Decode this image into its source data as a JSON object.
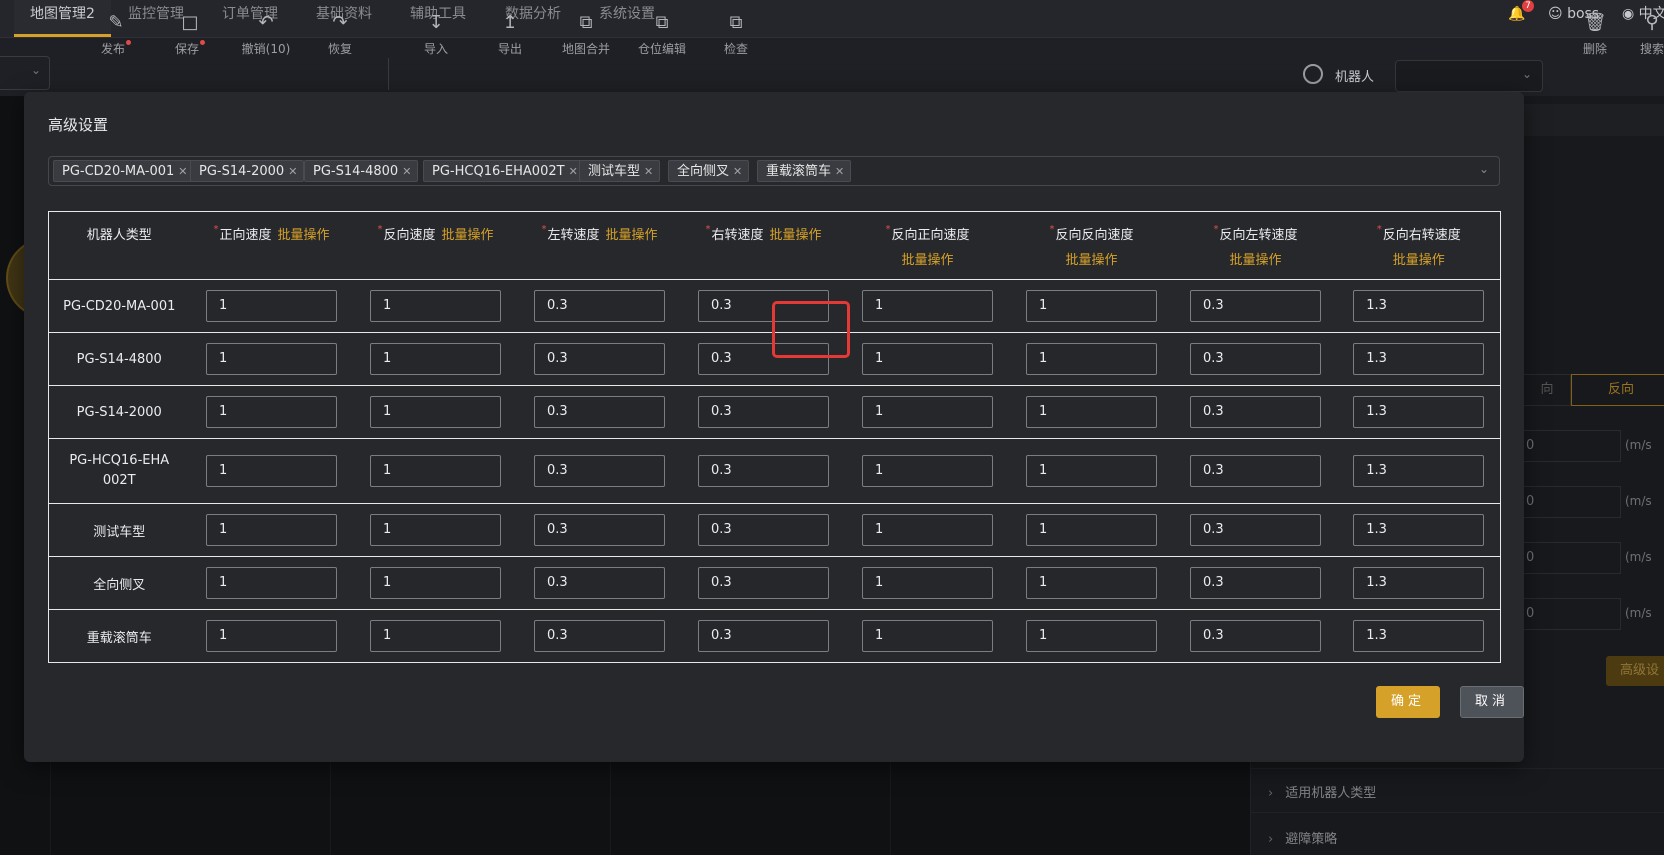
{
  "nav": {
    "tabs": [
      "地图管理2",
      "监控管理",
      "订单管理",
      "基础资料",
      "辅助工具",
      "数据分析",
      "系统设置"
    ],
    "badge_count": "7",
    "user": "boss",
    "lang": "中文"
  },
  "toolbar": {
    "buttons": [
      "发布",
      "保存",
      "撤销(10)",
      "恢复",
      "导入",
      "导出",
      "地图合并",
      "仓位编辑",
      "检查"
    ],
    "robot_label": "机器人",
    "right_buttons": [
      "删除",
      "搜索"
    ]
  },
  "right_panel": {
    "tab_forward": "向",
    "tab_reverse": "反向",
    "fields": [
      "0",
      "0",
      "0",
      "0"
    ],
    "unit": "(m/s",
    "advanced_button": "高级设",
    "sections": [
      "适用机器人类型",
      "避障策略"
    ]
  },
  "modal": {
    "title": "高级设置",
    "tags": [
      "PG-CD20-MA-001",
      "PG-S14-2000",
      "PG-S14-4800",
      "PG-HCQ16-EHA002T",
      "测试车型",
      "全向侧叉",
      "重载滚筒车"
    ],
    "columns": {
      "type": "机器人类型",
      "fwd": "正向速度",
      "rev": "反向速度",
      "left": "左转速度",
      "right": "右转速度",
      "rfwd": "反向正向速度",
      "rrev": "反向反向速度",
      "rleft": "反向左转速度",
      "rright": "反向右转速度",
      "batch": "批量操作"
    },
    "rows": [
      {
        "type": "PG-CD20-MA-001",
        "values": [
          "1",
          "1",
          "0.3",
          "0.3",
          "1",
          "1",
          "0.3",
          "1.3"
        ]
      },
      {
        "type": "PG-S14-4800",
        "values": [
          "1",
          "1",
          "0.3",
          "0.3",
          "1",
          "1",
          "0.3",
          "1.3"
        ]
      },
      {
        "type": "PG-S14-2000",
        "values": [
          "1",
          "1",
          "0.3",
          "0.3",
          "1",
          "1",
          "0.3",
          "1.3"
        ]
      },
      {
        "type": "PG-HCQ16-EHA002T",
        "values": [
          "1",
          "1",
          "0.3",
          "0.3",
          "1",
          "1",
          "0.3",
          "1.3"
        ]
      },
      {
        "type": "测试车型",
        "values": [
          "1",
          "1",
          "0.3",
          "0.3",
          "1",
          "1",
          "0.3",
          "1.3"
        ]
      },
      {
        "type": "全向侧叉",
        "values": [
          "1",
          "1",
          "0.3",
          "0.3",
          "1",
          "1",
          "0.3",
          "1.3"
        ]
      },
      {
        "type": "重载滚筒车",
        "values": [
          "1",
          "1",
          "0.3",
          "0.3",
          "1",
          "1",
          "0.3",
          "1.3"
        ]
      }
    ],
    "ok": "确定",
    "cancel": "取消"
  }
}
